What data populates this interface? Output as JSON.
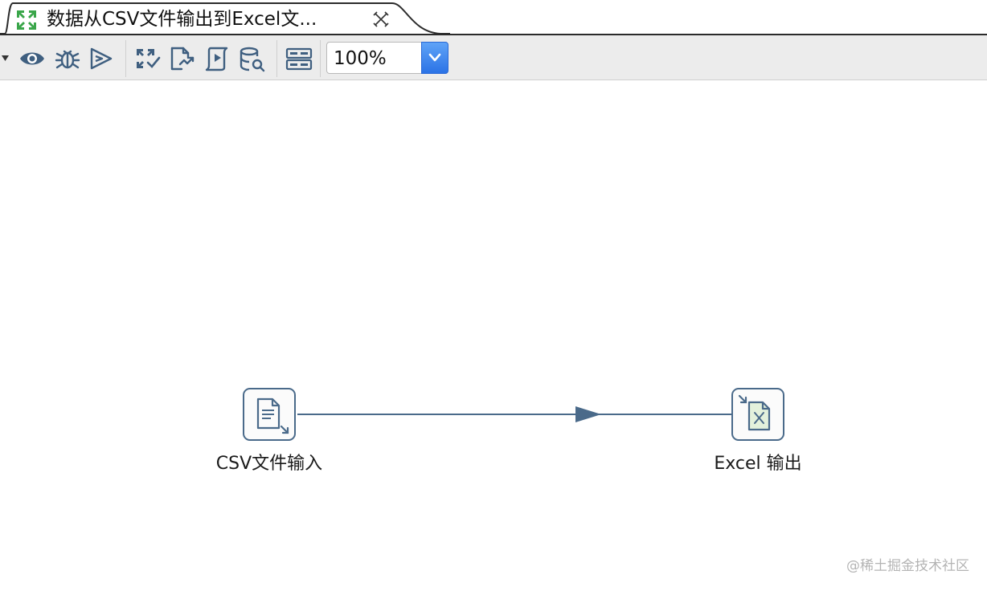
{
  "tab": {
    "title": "数据从CSV文件输出到Excel文...",
    "icon": "transformation-icon",
    "close_icon": "close-icon"
  },
  "toolbar": {
    "buttons": [
      {
        "name": "run-dropdown-arrow",
        "icon": "dropdown-triangle-icon"
      },
      {
        "name": "preview-button",
        "icon": "eye-icon"
      },
      {
        "name": "debug-button",
        "icon": "bug-icon"
      },
      {
        "name": "replay-button",
        "icon": "play-outline-icon"
      },
      {
        "name": "verify-button",
        "icon": "check-transformation-icon"
      },
      {
        "name": "impact-button",
        "icon": "impact-analysis-icon"
      },
      {
        "name": "sql-button",
        "icon": "sql-script-icon"
      },
      {
        "name": "explore-db-button",
        "icon": "database-search-icon"
      },
      {
        "name": "show-results-button",
        "icon": "results-panel-icon"
      }
    ],
    "zoom": {
      "value": "100%",
      "arrow_icon": "chevron-down-icon"
    }
  },
  "canvas": {
    "steps": [
      {
        "label": "CSV文件输入",
        "icon": "csv-input-icon"
      },
      {
        "label": "Excel 输出",
        "icon": "excel-output-icon"
      }
    ],
    "hop": {
      "from": "CSV文件输入",
      "to": "Excel 输出",
      "color": "#4a6a8a"
    }
  },
  "watermark": "@稀土掘金技术社区",
  "colors": {
    "accent": "#2b73e6",
    "tab_icon_green": "#3aa64a",
    "step_border": "#4a6a8a"
  }
}
